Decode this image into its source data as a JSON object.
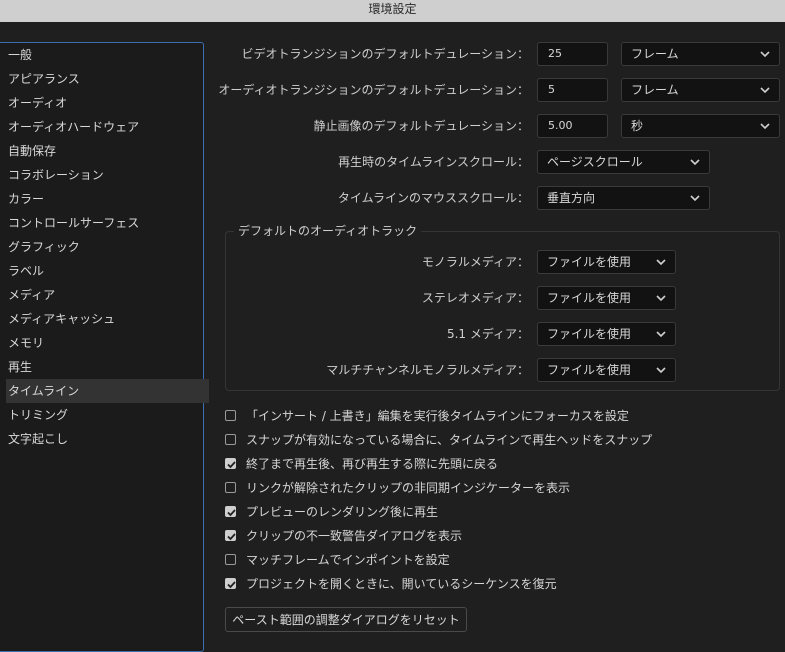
{
  "window": {
    "title": "環境設定"
  },
  "sidebar": {
    "items": [
      {
        "label": "一般"
      },
      {
        "label": "アピアランス"
      },
      {
        "label": "オーディオ"
      },
      {
        "label": "オーディオハードウェア"
      },
      {
        "label": "自動保存"
      },
      {
        "label": "コラボレーション"
      },
      {
        "label": "カラー"
      },
      {
        "label": "コントロールサーフェス"
      },
      {
        "label": "グラフィック"
      },
      {
        "label": "ラベル"
      },
      {
        "label": "メディア"
      },
      {
        "label": "メディアキャッシュ"
      },
      {
        "label": "メモリ"
      },
      {
        "label": "再生"
      },
      {
        "label": "タイムライン"
      },
      {
        "label": "トリミング"
      },
      {
        "label": "文字起こし"
      }
    ],
    "selected": "タイムライン"
  },
  "settings": {
    "video_transition": {
      "label": "ビデオトランジションのデフォルトデュレーション：",
      "value": "25",
      "unit": "フレーム"
    },
    "audio_transition": {
      "label": "オーディオトランジションのデフォルトデュレーション：",
      "value": "5",
      "unit": "フレーム"
    },
    "still_image": {
      "label": "静止画像のデフォルトデュレーション：",
      "value": "5.00",
      "unit": "秒"
    },
    "playback_scroll": {
      "label": "再生時のタイムラインスクロール：",
      "value": "ページスクロール"
    },
    "mouse_scroll": {
      "label": "タイムラインのマウススクロール：",
      "value": "垂直方向"
    }
  },
  "default_audio_tracks": {
    "title": "デフォルトのオーディオトラック",
    "mono": {
      "label": "モノラルメディア：",
      "value": "ファイルを使用"
    },
    "stereo": {
      "label": "ステレオメディア：",
      "value": "ファイルを使用"
    },
    "five_one": {
      "label": "5.1 メディア：",
      "value": "ファイルを使用"
    },
    "multichannel": {
      "label": "マルチチャンネルモノラルメディア：",
      "value": "ファイルを使用"
    }
  },
  "checkboxes": [
    {
      "label": "「インサート / 上書き」編集を実行後タイムラインにフォーカスを設定",
      "checked": false
    },
    {
      "label": "スナップが有効になっている場合に、タイムラインで再生ヘッドをスナップ",
      "checked": false
    },
    {
      "label": "終了まで再生後、再び再生する際に先頭に戻る",
      "checked": true
    },
    {
      "label": "リンクが解除されたクリップの非同期インジケーターを表示",
      "checked": false
    },
    {
      "label": "プレビューのレンダリング後に再生",
      "checked": true
    },
    {
      "label": "クリップの不一致警告ダイアログを表示",
      "checked": true
    },
    {
      "label": "マッチフレームでインポイントを設定",
      "checked": false
    },
    {
      "label": "プロジェクトを開くときに、開いているシーケンスを復元",
      "checked": true
    }
  ],
  "reset_button": {
    "label": "ペースト範囲の調整ダイアログをリセット"
  },
  "icons": {
    "dropdown": "chevron-down-icon",
    "check": "checkmark-icon"
  }
}
